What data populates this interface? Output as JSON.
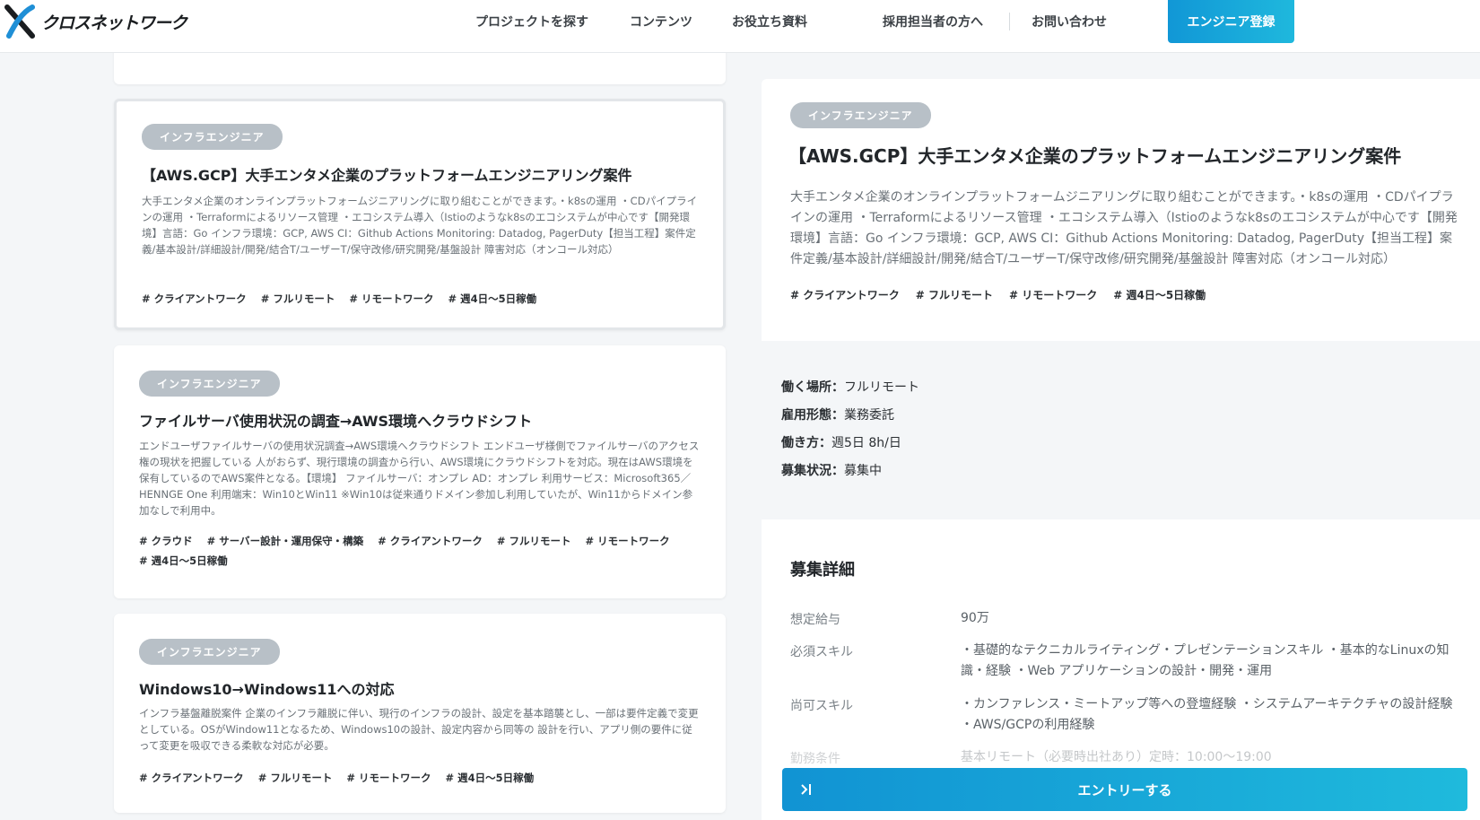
{
  "header": {
    "logo_text": "クロスネットワーク",
    "nav": [
      {
        "label": "プロジェクトを探す"
      },
      {
        "label": "コンテンツ"
      },
      {
        "label": "お役立ち資料"
      },
      {
        "label": "採用担当者の方へ"
      },
      {
        "label": "お問い合わせ"
      }
    ],
    "register_label": "エンジニア登録"
  },
  "cards": [
    {
      "category": "インフラエンジニア",
      "title": "【AWS.GCP】大手エンタメ企業のプラットフォームエンジニアリング案件",
      "description": "大手エンタメ企業のオンラインプラットフォームジニアリングに取り組むことができます。・k8sの運用 ・CDパイプラインの運用 ・Terraformによるリソース管理 ・エコシステム導入（Istioのようなk8sのエコシステムが中心です【開発環境】言語：Go インフラ環境：GCP, AWS CI：Github Actions Monitoring: Datadog, PagerDuty【担当工程】案件定義/基本設計/詳細設計/開発/結合T/ユーザーT/保守改修/研究開発/基盤設計 障害対応（オンコール対応）",
      "tags": [
        "# クライアントワーク",
        "# フルリモート",
        "# リモートワーク",
        "# 週4日〜5日稼働"
      ]
    },
    {
      "category": "インフラエンジニア",
      "title": "ファイルサーバ使用状況の調査→AWS環境へクラウドシフト",
      "description": "エンドユーザファイルサーバの使用状況調査→AWS環境へクラウドシフト エンドユーザ様側でファイルサーバのアクセス権の現状を把握している 人がおらず、現行環境の調査から行い、AWS環境にクラウドシフトを対応。現在はAWS環境を保有しているのでAWS案件となる。【環境】 ファイルサーバ：オンプレ AD：オンプレ 利用サービス：Microsoft365／HENNGE One 利用端末：Win10とWin11 ※Win10は従来通りドメイン参加し利用していたが、Win11からドメイン参加なしで利用中。",
      "tags": [
        "# クラウド",
        "# サーバー設計・運用保守・構築",
        "# クライアントワーク",
        "# フルリモート",
        "# リモートワーク",
        "# 週4日〜5日稼働"
      ]
    },
    {
      "category": "インフラエンジニア",
      "title": "Windows10→Windows11への対応",
      "description": "インフラ基盤離脱案件 企業のインフラ離脱に伴い、現行のインフラの設計、設定を基本踏襲とし、一部は要件定義で変更としている。OSがWindow11となるため、Windows10の設計、設定内容から同等の 設計を行い、アプリ側の要件に従って変更を吸収できる柔軟な対応が必要。",
      "tags": [
        "# クライアントワーク",
        "# フルリモート",
        "# リモートワーク",
        "# 週4日〜5日稼働"
      ]
    }
  ],
  "detail": {
    "category": "インフラエンジニア",
    "title": "【AWS.GCP】大手エンタメ企業のプラットフォームエンジニアリング案件",
    "description": "大手エンタメ企業のオンラインプラットフォームジニアリングに取り組むことができます。・k8sの運用 ・CDパイプラインの運用 ・Terraformによるリソース管理 ・エコシステム導入（Istioのようなk8sのエコシステムが中心です【開発環境】言語：Go インフラ環境：GCP, AWS CI：Github Actions Monitoring: Datadog, PagerDuty【担当工程】案件定義/基本設計/詳細設計/開発/結合T/ユーザーT/保守改修/研究開発/基盤設計 障害対応（オンコール対応）",
    "tags": [
      "# クライアントワーク",
      "# フルリモート",
      "# リモートワーク",
      "# 週4日〜5日稼働"
    ],
    "info": [
      {
        "key": "働く場所：",
        "value": "フルリモート"
      },
      {
        "key": "雇用形態：",
        "value": "業務委託"
      },
      {
        "key": "働き方：",
        "value": "週5日 8h/日"
      },
      {
        "key": "募集状況：",
        "value": "募集中"
      }
    ],
    "section_title": "募集詳細",
    "rows": [
      {
        "key": "想定給与",
        "value": "90万"
      },
      {
        "key": "必須スキル",
        "value": "・基礎的なテクニカルライティング・プレゼンテーションスキル ・基本的なLinuxの知識・経験 ・Web アプリケーションの設計・開発・運用"
      },
      {
        "key": "尚可スキル",
        "value": "・カンファレンス・ミートアップ等への登壇経験 ・システムアーキテクチャの設計経験 ・AWS/GCPの利用経験"
      },
      {
        "key": "勤務条件",
        "value": "基本リモート（必要時出社あり）定時：10:00〜19:00"
      }
    ],
    "entry_label": "エントリーする"
  },
  "colors": {
    "accent": "#1197d6",
    "badge": "#b8c0c7",
    "background": "#f4f6f8"
  }
}
